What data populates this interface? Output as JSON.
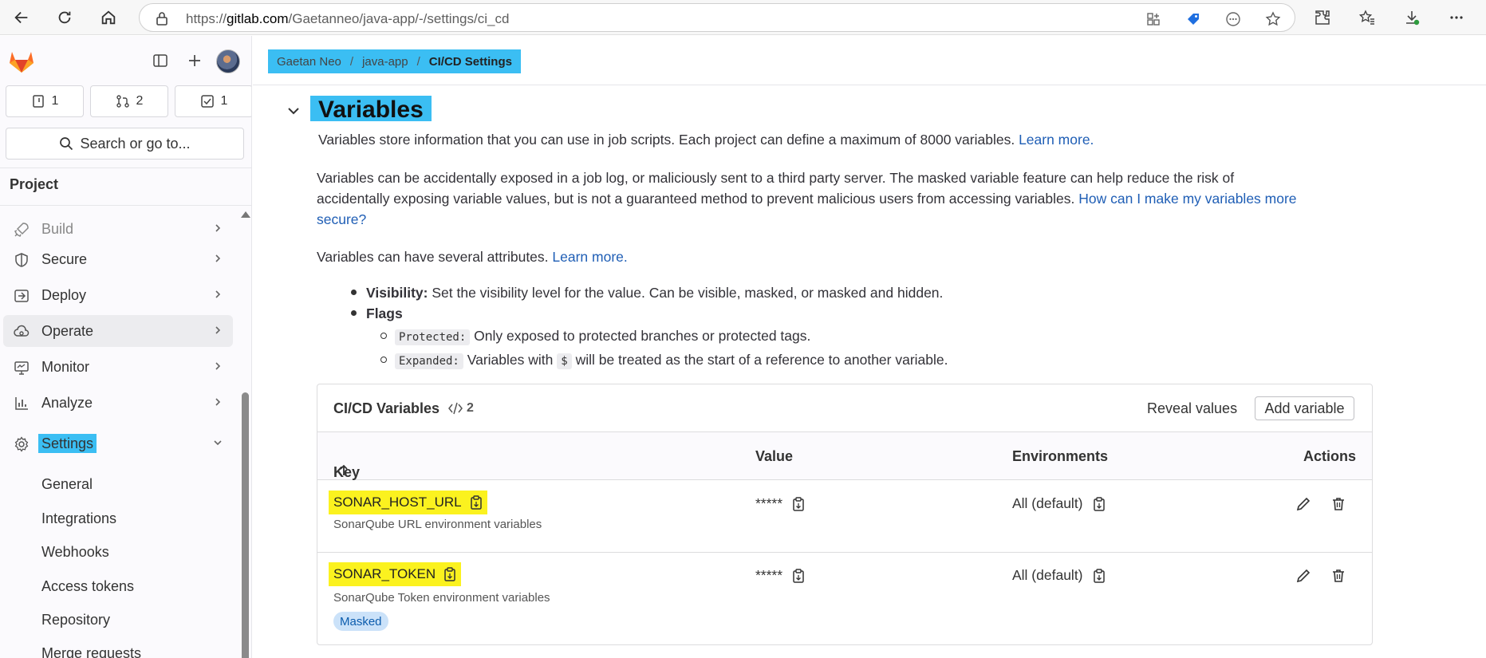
{
  "browser": {
    "url_prefix": "https://",
    "url_host": "gitlab.com",
    "url_path": "/Gaetanneo/java-app/-/settings/ci_cd"
  },
  "sidebar": {
    "counters": [
      {
        "icon": "issues-icon",
        "count": "1"
      },
      {
        "icon": "merge-request-icon",
        "count": "2"
      },
      {
        "icon": "todo-icon",
        "count": "1"
      }
    ],
    "search_label": "Search or go to...",
    "section_title": "Project",
    "items": [
      {
        "label": "Build",
        "icon": "rocket-icon"
      },
      {
        "label": "Secure",
        "icon": "shield-icon"
      },
      {
        "label": "Deploy",
        "icon": "deploy-icon"
      },
      {
        "label": "Operate",
        "icon": "cloud-gear-icon"
      },
      {
        "label": "Monitor",
        "icon": "monitor-icon"
      },
      {
        "label": "Analyze",
        "icon": "chart-icon"
      },
      {
        "label": "Settings",
        "icon": "gear-icon"
      }
    ],
    "settings_subitems": [
      "General",
      "Integrations",
      "Webhooks",
      "Access tokens",
      "Repository",
      "Merge requests"
    ]
  },
  "breadcrumb": [
    "Gaetan Neo",
    "java-app",
    "CI/CD Settings"
  ],
  "section": {
    "title": "Variables",
    "intro": "Variables store information that you can use in job scripts. Each project can define a maximum of 8000 variables.",
    "intro_link": "Learn more.",
    "warning_line1": "Variables can be accidentally exposed in a job log, or maliciously sent to a third party server. The masked variable feature can help reduce the risk of",
    "warning_line2": "accidentally exposing variable values, but is not a guaranteed method to prevent malicious users from accessing variables.",
    "warning_link_a": "How can I make my variables more",
    "warning_link_b": "secure?",
    "attributes_text": "Variables can have several attributes.",
    "attributes_link": "Learn more.",
    "visibility_label": "Visibility:",
    "visibility_text": "Set the visibility level for the value. Can be visible, masked, or masked and hidden.",
    "flags_label": "Flags",
    "protected_code": "Protected:",
    "protected_text": "Only exposed to protected branches or protected tags.",
    "expanded_code": "Expanded:",
    "expanded_text_a": "Variables with",
    "expanded_dollar": "$",
    "expanded_text_b": "will be treated as the start of a reference to another variable."
  },
  "table": {
    "title": "CI/CD Variables",
    "count": "2",
    "reveal_label": "Reveal values",
    "add_label": "Add variable",
    "headers": {
      "key": "Key",
      "value": "Value",
      "environments": "Environments",
      "actions": "Actions"
    },
    "rows": [
      {
        "key": "SONAR_HOST_URL",
        "description": "SonarQube URL environment variables",
        "value": "*****",
        "environment": "All (default)",
        "badge": ""
      },
      {
        "key": "SONAR_TOKEN",
        "description": "SonarQube Token environment variables",
        "value": "*****",
        "environment": "All (default)",
        "badge": "Masked"
      }
    ]
  },
  "colors": {
    "highlight_blue": "#3bbef3",
    "highlight_yellow": "#fbf21f",
    "link": "#1f5eb5"
  }
}
